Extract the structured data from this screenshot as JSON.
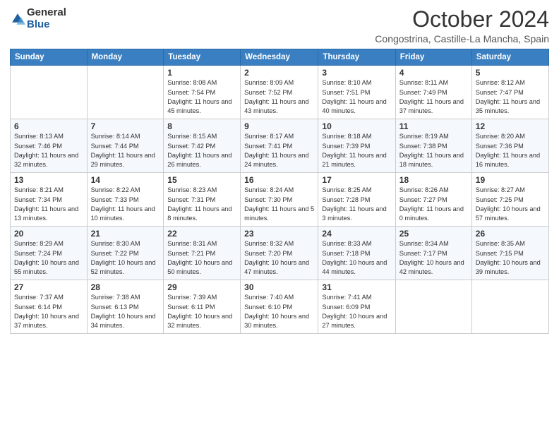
{
  "logo": {
    "general": "General",
    "blue": "Blue"
  },
  "header": {
    "title": "October 2024",
    "subtitle": "Congostrina, Castille-La Mancha, Spain"
  },
  "weekdays": [
    "Sunday",
    "Monday",
    "Tuesday",
    "Wednesday",
    "Thursday",
    "Friday",
    "Saturday"
  ],
  "weeks": [
    [
      {
        "day": "",
        "info": ""
      },
      {
        "day": "",
        "info": ""
      },
      {
        "day": "1",
        "info": "Sunrise: 8:08 AM\nSunset: 7:54 PM\nDaylight: 11 hours and 45 minutes."
      },
      {
        "day": "2",
        "info": "Sunrise: 8:09 AM\nSunset: 7:52 PM\nDaylight: 11 hours and 43 minutes."
      },
      {
        "day": "3",
        "info": "Sunrise: 8:10 AM\nSunset: 7:51 PM\nDaylight: 11 hours and 40 minutes."
      },
      {
        "day": "4",
        "info": "Sunrise: 8:11 AM\nSunset: 7:49 PM\nDaylight: 11 hours and 37 minutes."
      },
      {
        "day": "5",
        "info": "Sunrise: 8:12 AM\nSunset: 7:47 PM\nDaylight: 11 hours and 35 minutes."
      }
    ],
    [
      {
        "day": "6",
        "info": "Sunrise: 8:13 AM\nSunset: 7:46 PM\nDaylight: 11 hours and 32 minutes."
      },
      {
        "day": "7",
        "info": "Sunrise: 8:14 AM\nSunset: 7:44 PM\nDaylight: 11 hours and 29 minutes."
      },
      {
        "day": "8",
        "info": "Sunrise: 8:15 AM\nSunset: 7:42 PM\nDaylight: 11 hours and 26 minutes."
      },
      {
        "day": "9",
        "info": "Sunrise: 8:17 AM\nSunset: 7:41 PM\nDaylight: 11 hours and 24 minutes."
      },
      {
        "day": "10",
        "info": "Sunrise: 8:18 AM\nSunset: 7:39 PM\nDaylight: 11 hours and 21 minutes."
      },
      {
        "day": "11",
        "info": "Sunrise: 8:19 AM\nSunset: 7:38 PM\nDaylight: 11 hours and 18 minutes."
      },
      {
        "day": "12",
        "info": "Sunrise: 8:20 AM\nSunset: 7:36 PM\nDaylight: 11 hours and 16 minutes."
      }
    ],
    [
      {
        "day": "13",
        "info": "Sunrise: 8:21 AM\nSunset: 7:34 PM\nDaylight: 11 hours and 13 minutes."
      },
      {
        "day": "14",
        "info": "Sunrise: 8:22 AM\nSunset: 7:33 PM\nDaylight: 11 hours and 10 minutes."
      },
      {
        "day": "15",
        "info": "Sunrise: 8:23 AM\nSunset: 7:31 PM\nDaylight: 11 hours and 8 minutes."
      },
      {
        "day": "16",
        "info": "Sunrise: 8:24 AM\nSunset: 7:30 PM\nDaylight: 11 hours and 5 minutes."
      },
      {
        "day": "17",
        "info": "Sunrise: 8:25 AM\nSunset: 7:28 PM\nDaylight: 11 hours and 3 minutes."
      },
      {
        "day": "18",
        "info": "Sunrise: 8:26 AM\nSunset: 7:27 PM\nDaylight: 11 hours and 0 minutes."
      },
      {
        "day": "19",
        "info": "Sunrise: 8:27 AM\nSunset: 7:25 PM\nDaylight: 10 hours and 57 minutes."
      }
    ],
    [
      {
        "day": "20",
        "info": "Sunrise: 8:29 AM\nSunset: 7:24 PM\nDaylight: 10 hours and 55 minutes."
      },
      {
        "day": "21",
        "info": "Sunrise: 8:30 AM\nSunset: 7:22 PM\nDaylight: 10 hours and 52 minutes."
      },
      {
        "day": "22",
        "info": "Sunrise: 8:31 AM\nSunset: 7:21 PM\nDaylight: 10 hours and 50 minutes."
      },
      {
        "day": "23",
        "info": "Sunrise: 8:32 AM\nSunset: 7:20 PM\nDaylight: 10 hours and 47 minutes."
      },
      {
        "day": "24",
        "info": "Sunrise: 8:33 AM\nSunset: 7:18 PM\nDaylight: 10 hours and 44 minutes."
      },
      {
        "day": "25",
        "info": "Sunrise: 8:34 AM\nSunset: 7:17 PM\nDaylight: 10 hours and 42 minutes."
      },
      {
        "day": "26",
        "info": "Sunrise: 8:35 AM\nSunset: 7:15 PM\nDaylight: 10 hours and 39 minutes."
      }
    ],
    [
      {
        "day": "27",
        "info": "Sunrise: 7:37 AM\nSunset: 6:14 PM\nDaylight: 10 hours and 37 minutes."
      },
      {
        "day": "28",
        "info": "Sunrise: 7:38 AM\nSunset: 6:13 PM\nDaylight: 10 hours and 34 minutes."
      },
      {
        "day": "29",
        "info": "Sunrise: 7:39 AM\nSunset: 6:11 PM\nDaylight: 10 hours and 32 minutes."
      },
      {
        "day": "30",
        "info": "Sunrise: 7:40 AM\nSunset: 6:10 PM\nDaylight: 10 hours and 30 minutes."
      },
      {
        "day": "31",
        "info": "Sunrise: 7:41 AM\nSunset: 6:09 PM\nDaylight: 10 hours and 27 minutes."
      },
      {
        "day": "",
        "info": ""
      },
      {
        "day": "",
        "info": ""
      }
    ]
  ]
}
